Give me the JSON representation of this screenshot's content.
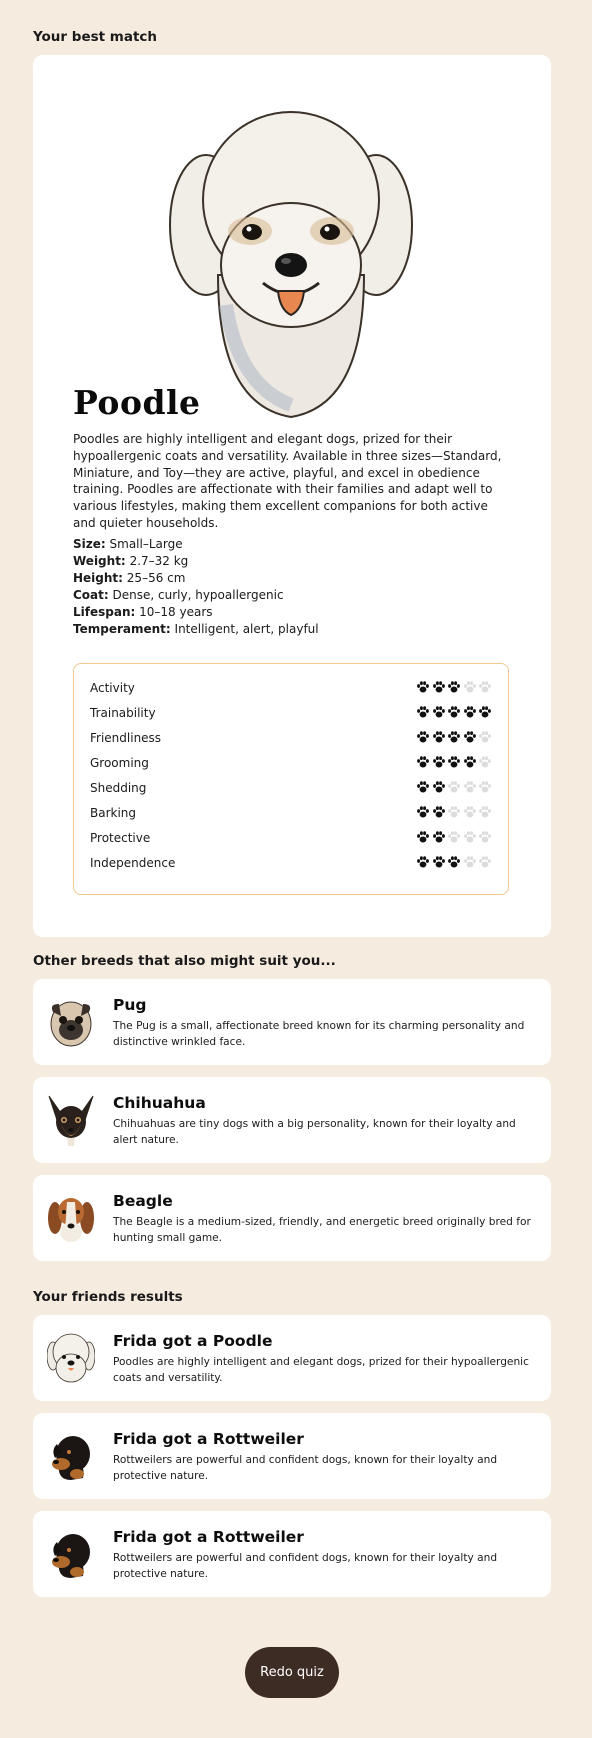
{
  "best_match": {
    "section_title": "Your best match",
    "breed_name": "Poodle",
    "description": "Poodles are highly intelligent and elegant dogs, prized for their hypoallergenic coats and versatility. Available in three sizes—Standard, Miniature, and Toy—they are active, playful, and excel in obedience training. Poodles are affectionate with their families and adapt well to various lifestyles, making them excellent companions for both active and quieter households.",
    "facts": [
      {
        "label": "Size:",
        "value": "Small–Large"
      },
      {
        "label": "Weight:",
        "value": "2.7–32 kg"
      },
      {
        "label": "Height:",
        "value": "25–56 cm"
      },
      {
        "label": "Coat:",
        "value": "Dense, curly, hypoallergenic"
      },
      {
        "label": "Lifespan:",
        "value": "10–18 years"
      },
      {
        "label": "Temperament:",
        "value": "Intelligent, alert, playful"
      }
    ],
    "traits": [
      {
        "name": "Activity",
        "rating": 3,
        "max": 5
      },
      {
        "name": "Trainability",
        "rating": 5,
        "max": 5
      },
      {
        "name": "Friendliness",
        "rating": 4,
        "max": 5
      },
      {
        "name": "Grooming",
        "rating": 4,
        "max": 5
      },
      {
        "name": "Shedding",
        "rating": 2,
        "max": 5
      },
      {
        "name": "Barking",
        "rating": 2,
        "max": 5
      },
      {
        "name": "Protective",
        "rating": 2,
        "max": 5
      },
      {
        "name": "Independence",
        "rating": 3,
        "max": 5
      }
    ]
  },
  "other_breeds": {
    "section_title": "Other breeds that also might suit you...",
    "items": [
      {
        "title": "Pug",
        "description": "The Pug is a small, affectionate breed known for its charming personality and distinctive wrinkled face.",
        "icon": "pug-icon"
      },
      {
        "title": "Chihuahua",
        "description": "Chihuahuas are tiny dogs with a big personality, known for their loyalty and alert nature.",
        "icon": "chihuahua-icon"
      },
      {
        "title": "Beagle",
        "description": "The Beagle is a medium-sized, friendly, and energetic breed originally bred for hunting small game.",
        "icon": "beagle-icon"
      }
    ]
  },
  "friends": {
    "section_title": "Your friends results",
    "items": [
      {
        "title": "Frida got a Poodle",
        "description": "Poodles are highly intelligent and elegant dogs, prized for their hypoallergenic coats and versatility.",
        "icon": "poodle-icon"
      },
      {
        "title": "Frida got a Rottweiler",
        "description": "Rottweilers are powerful and confident dogs, known for their loyalty and protective nature.",
        "icon": "rottweiler-icon"
      },
      {
        "title": "Frida got a Rottweiler",
        "description": "Rottweilers are powerful and confident dogs, known for their loyalty and protective nature.",
        "icon": "rottweiler-icon"
      }
    ]
  },
  "redo_label": "Redo quiz",
  "colors": {
    "background": "#f5ebdf",
    "card": "#ffffff",
    "trait_border": "#f0c890",
    "paw_filled": "#111111",
    "paw_empty": "#dcdcdc",
    "button": "#3d2c24"
  }
}
